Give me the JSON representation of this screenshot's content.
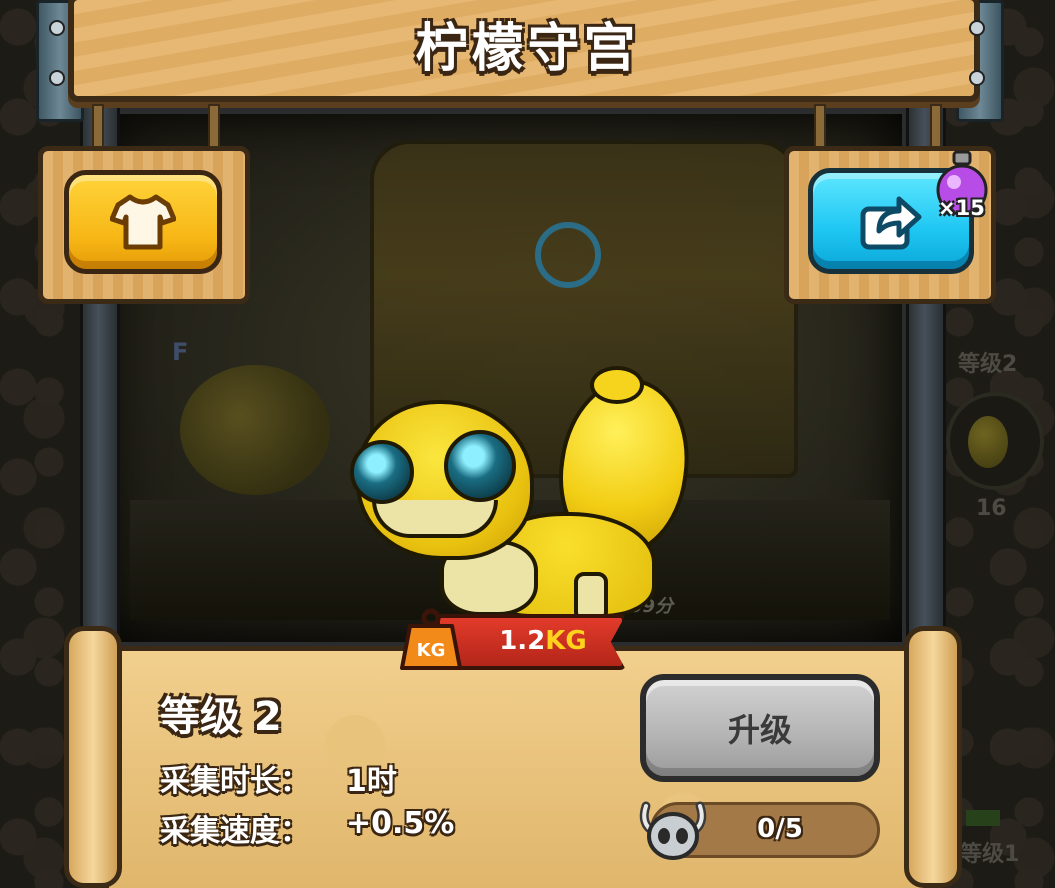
{
  "header": {
    "title": "柠檬守宫"
  },
  "buttons": {
    "outfit_icon": "shirt-icon",
    "share_icon": "share-icon",
    "upgrade_label": "升级"
  },
  "potion": {
    "icon": "purple-potion-icon",
    "count": "×15"
  },
  "side_panel": {
    "level_label": "等级2",
    "count": "16",
    "bottom_level_label": "等级1"
  },
  "scene": {
    "timer": "59分",
    "marker": "F"
  },
  "creature": {
    "weight_value": "1.2",
    "weight_unit": "KG",
    "kg_icon_label": "KG"
  },
  "info": {
    "level_title": "等级 2",
    "stats": [
      {
        "label": "采集时长：",
        "value": "1时"
      },
      {
        "label": "采集速度：",
        "value": "+0.5%"
      }
    ]
  },
  "progress": {
    "text": "0/5",
    "current": 0,
    "max": 5,
    "icon": "horned-skull-icon"
  },
  "colors": {
    "title_plank": "#e7b873",
    "outfit_button": "#f6b514",
    "share_button": "#1ec6f2",
    "weight_ribbon": "#c62e20",
    "upgrade_button": "#b3b3b3"
  }
}
